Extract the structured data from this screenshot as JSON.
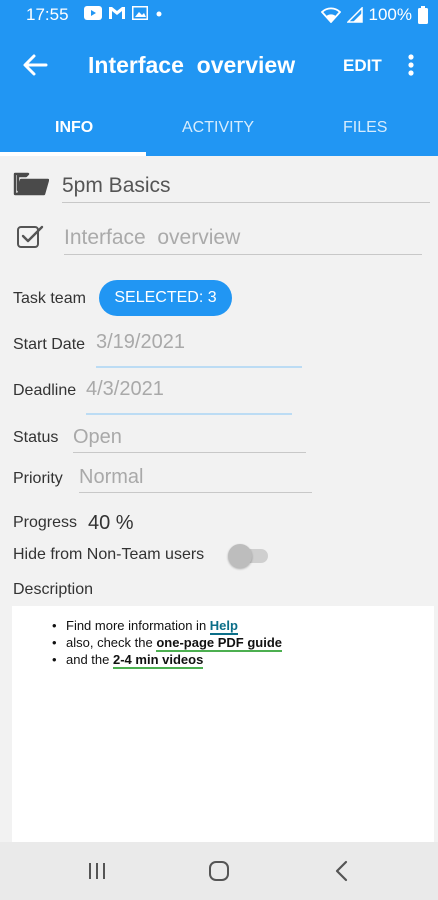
{
  "statusbar": {
    "time": "17:55",
    "battery": "100%",
    "icons": [
      "youtube-icon",
      "gmail-icon",
      "gallery-icon",
      "dot-icon",
      "wifi-icon",
      "signal-icon",
      "battery-icon"
    ]
  },
  "appbar": {
    "title": "Interface  overview",
    "edit_label": "EDIT",
    "back_icon": "arrow-left-icon",
    "more_icon": "more-vertical-icon",
    "color": "#2196f3"
  },
  "tabs": [
    {
      "label": "INFO",
      "active": true
    },
    {
      "label": "ACTIVITY",
      "active": false
    },
    {
      "label": "FILES",
      "active": false
    }
  ],
  "form": {
    "project": {
      "value": "5pm Basics",
      "icon": "folder-icon"
    },
    "task": {
      "placeholder": "Interface  overview",
      "icon": "checkbox-icon"
    },
    "task_team": {
      "label": "Task team",
      "button": "SELECTED: 3"
    },
    "start_date": {
      "label": "Start Date",
      "value": "3/19/2021"
    },
    "deadline": {
      "label": "Deadline",
      "value": "4/3/2021"
    },
    "status": {
      "label": "Status",
      "value": "Open"
    },
    "priority": {
      "label": "Priority",
      "value": "Normal"
    },
    "progress": {
      "label": "Progress",
      "value": "40 %"
    },
    "hide": {
      "label": "Hide from Non-Team users",
      "checked": false
    },
    "description": {
      "label": "Description",
      "items": [
        {
          "text": "Find more information in ",
          "link": "Help"
        },
        {
          "text": "also, check the ",
          "link": "one-page PDF guide"
        },
        {
          "text": "and the ",
          "link": "2-4 min videos"
        }
      ]
    }
  },
  "navbar": {
    "icons": [
      "recents-icon",
      "home-icon",
      "back-icon"
    ]
  }
}
